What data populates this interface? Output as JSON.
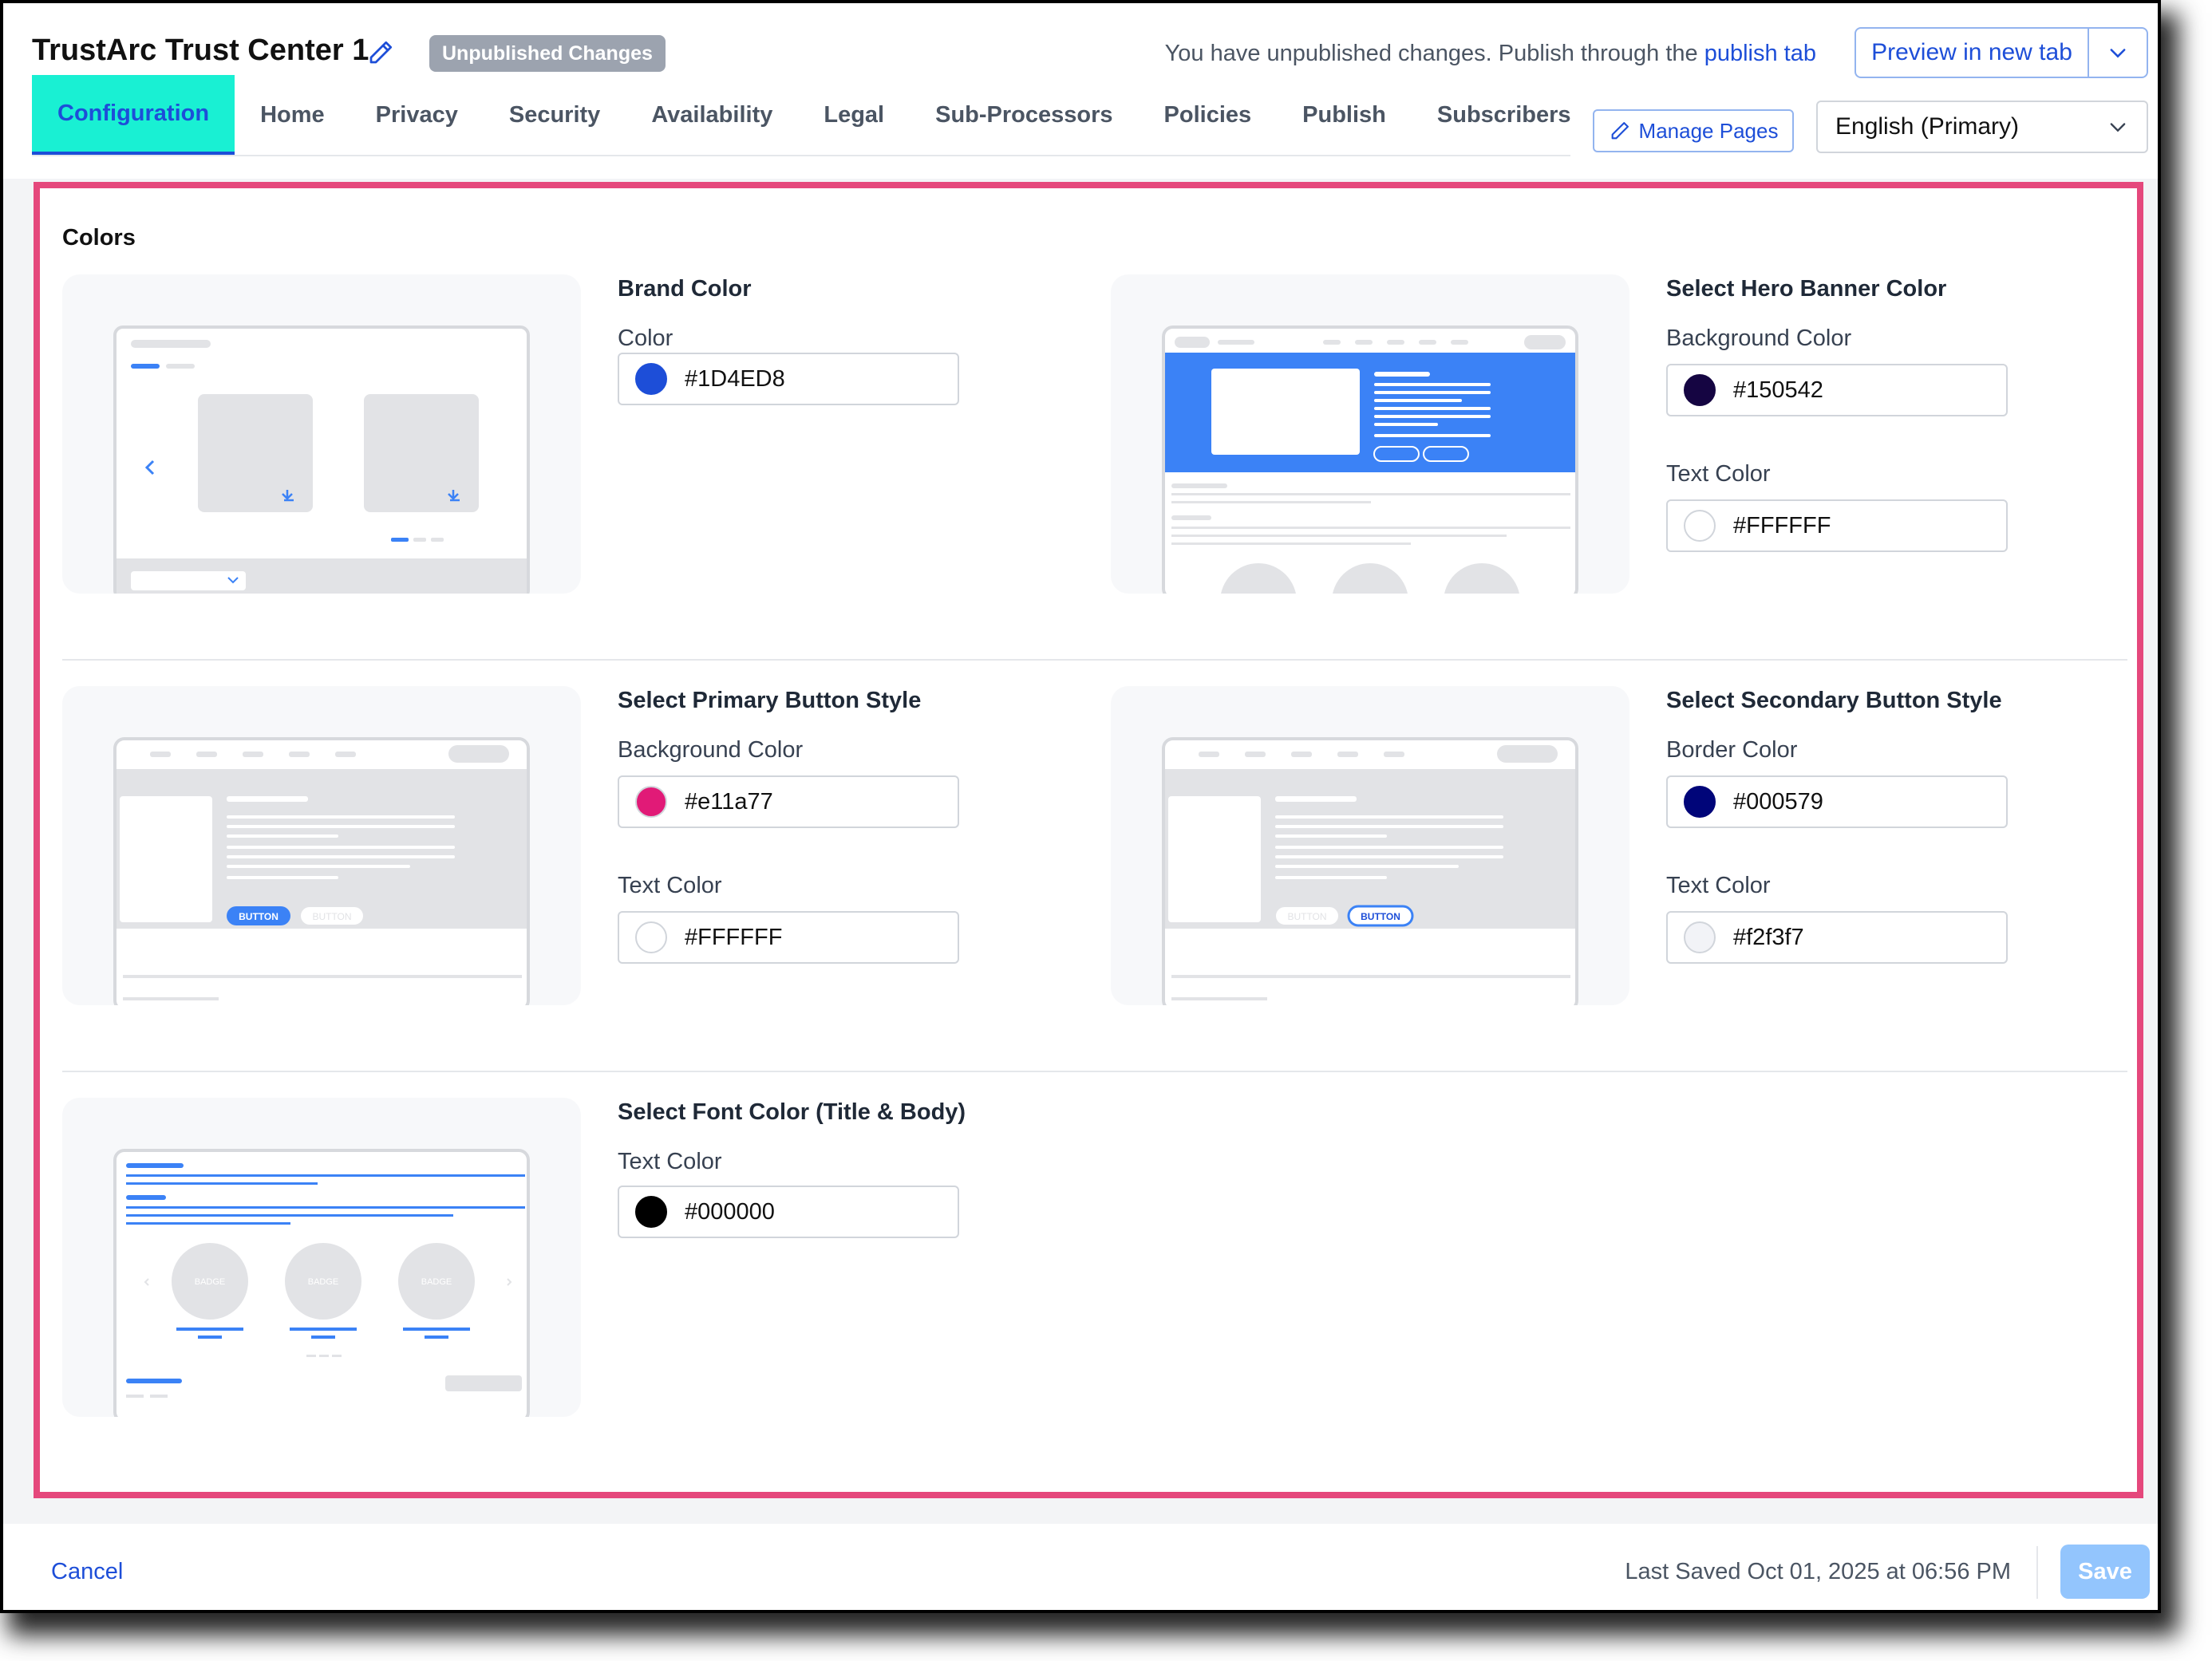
{
  "header": {
    "title": "TrustArc Trust Center 1",
    "badge": "Unpublished Changes",
    "notice_text": "You have unpublished changes. Publish through the",
    "notice_link": "publish tab",
    "preview_label": "Preview in new tab"
  },
  "tabs": [
    {
      "label": "Configuration",
      "active": true
    },
    {
      "label": "Home"
    },
    {
      "label": "Privacy"
    },
    {
      "label": "Security"
    },
    {
      "label": "Availability"
    },
    {
      "label": "Legal"
    },
    {
      "label": "Sub-Processors"
    },
    {
      "label": "Policies"
    },
    {
      "label": "Publish"
    },
    {
      "label": "Subscribers"
    }
  ],
  "toolbar": {
    "manage_pages": "Manage Pages",
    "language": "English (Primary)"
  },
  "colors": {
    "section_title": "Colors",
    "brand": {
      "title": "Brand Color",
      "label": "Color",
      "value": "#1D4ED8",
      "swatch": "#1D4ED8"
    },
    "hero": {
      "title": "Select Hero Banner Color",
      "bg_label": "Background Color",
      "bg_value": "#150542",
      "bg_swatch": "#150542",
      "text_label": "Text Color",
      "text_value": "#FFFFFF",
      "text_swatch": "#FFFFFF"
    },
    "primary": {
      "title": "Select Primary Button Style",
      "bg_label": "Background Color",
      "bg_value": "#e11a77",
      "bg_swatch": "#e11a77",
      "text_label": "Text Color",
      "text_value": "#FFFFFF",
      "text_swatch": "#FFFFFF"
    },
    "secondary": {
      "title": "Select Secondary Button Style",
      "border_label": "Border Color",
      "border_value": "#000579",
      "border_swatch": "#000579",
      "text_label": "Text Color",
      "text_value": "#f2f3f7",
      "text_swatch": "#f2f3f7"
    },
    "font": {
      "title": "Select Font Color (Title & Body)",
      "label": "Text Color",
      "value": "#000000",
      "swatch": "#000000"
    }
  },
  "previews": {
    "button_label": "BUTTON",
    "badge_label": "BADGE"
  },
  "footer": {
    "cancel": "Cancel",
    "last_saved": "Last Saved Oct 01, 2025 at 06:56 PM",
    "save": "Save"
  },
  "palette": {
    "accent": "#1D4ED8",
    "active_tab_bg": "#19F0D3",
    "highlight_border": "#E5487C",
    "preview_blue": "#3B82F6",
    "preview_gray": "#E2E3E6"
  }
}
